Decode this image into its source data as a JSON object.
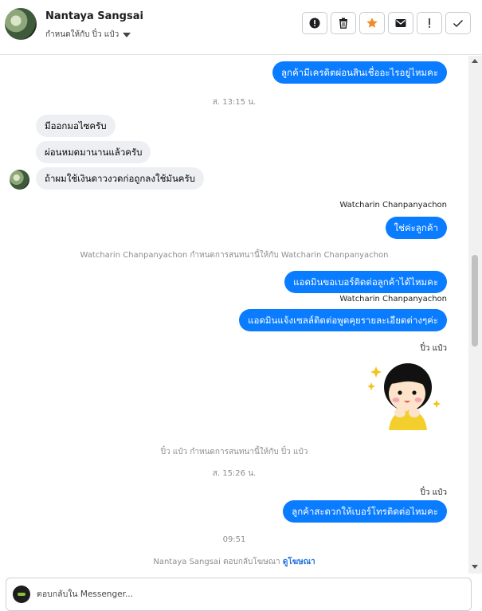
{
  "header": {
    "contact_name": "Nantaya Sangsai",
    "assigned_label": "กำหนดให้กับ ปิ๋ว แป๋ว",
    "actions": [
      {
        "icon": "alert-circle-icon",
        "name": "mark-spam-button"
      },
      {
        "icon": "trash-icon",
        "name": "delete-button"
      },
      {
        "icon": "star-icon",
        "name": "star-button",
        "color": "#f28c28"
      },
      {
        "icon": "envelope-icon",
        "name": "mark-unread-button"
      },
      {
        "icon": "exclamation-icon",
        "name": "follow-up-button"
      },
      {
        "icon": "check-icon",
        "name": "mark-done-button"
      }
    ]
  },
  "messages": {
    "out_1": "ลูกค้ามีเครดิตผ่อนสินเชื่ออะไรอยู่ไหมคะ",
    "time_1": "ส. 13:15 น.",
    "in_1": "มีออกมอไซครับ",
    "in_2": "ผ่อนหมดมานานแล้วครับ",
    "in_3": "ถ้าผมใช้เงินดาวงวดก่อถูกลงใช้มันครับ",
    "sender_1": "Watcharin Chanpanyachon",
    "out_2": "ใช่ค่ะลูกค้า",
    "sys_1": "Watcharin Chanpanyachon กำหนดการสนทนานี้ให้กับ Watcharin Chanpanyachon",
    "out_3": "แอดมินขอเบอร์ติดต่อลูกค้าได้ไหมคะ",
    "sender_2": "Watcharin Chanpanyachon",
    "out_4": "แอดมินแจ้งเซลล์ติดต่อพูดคุยรายละเอียดต่างๆค่ะ",
    "sender_3": "ปิ๋ว แป๋ว",
    "sys_2": "ปิ๋ว แป๋ว กำหนดการสนทนานี้ให้กับ ปิ๋ว แป๋ว",
    "time_2": "ส. 15:26 น.",
    "sender_4": "ปิ๋ว แป๋ว",
    "out_5": "ลูกค้าสะดวกให้เบอร์โทรติดต่อไหมคะ",
    "time_3": "09:51",
    "sys_3_prefix": "Nantaya Sangsai ตอบกลับโฆษณา",
    "sys_3_link": "ดูโฆษณา"
  },
  "colors": {
    "outgoing_bubble": "#0a7cff",
    "incoming_bubble": "#eeeff2",
    "link": "#216fdb"
  },
  "composer": {
    "placeholder": "ตอบกลับใน Messenger..."
  }
}
